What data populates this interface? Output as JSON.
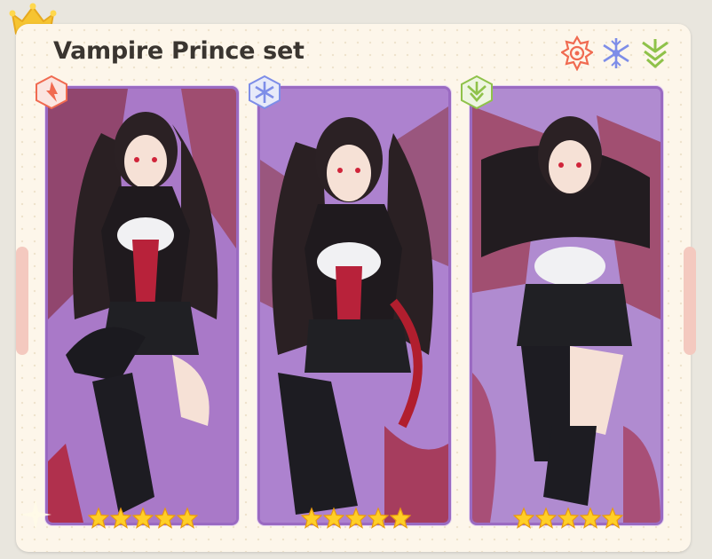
{
  "set": {
    "title": "Vampire Prince set"
  },
  "header_icons": [
    "fire-element-icon",
    "ice-element-icon",
    "nature-element-icon"
  ],
  "cards": [
    {
      "element_icon": "fire-element-icon",
      "rarity_stars": 5
    },
    {
      "element_icon": "ice-element-icon",
      "rarity_stars": 5
    },
    {
      "element_icon": "nature-element-icon",
      "rarity_stars": 5
    }
  ],
  "colors": {
    "fire": "#f06a50",
    "ice": "#7d8de8",
    "nature": "#8fc24a",
    "card_border": "#9a6ac2",
    "card_bg": "#b98ad6",
    "star": "#ffcf26"
  }
}
